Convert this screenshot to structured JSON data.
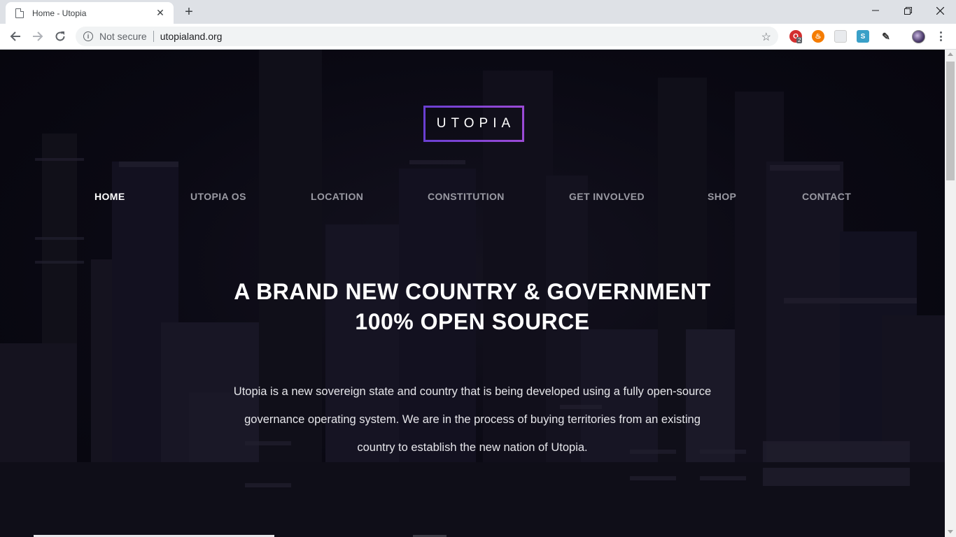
{
  "browser": {
    "tab_title": "Home - Utopia",
    "security_label": "Not secure",
    "url": "utopialand.org",
    "extension_badge": "2"
  },
  "site": {
    "logo_text": "UTOPIA",
    "nav": [
      {
        "label": "HOME",
        "active": true
      },
      {
        "label": "UTOPIA OS"
      },
      {
        "label": "LOCATION"
      },
      {
        "label": "CONSTITUTION"
      },
      {
        "label": "GET INVOLVED"
      },
      {
        "label": "SHOP"
      },
      {
        "label": "CONTACT"
      }
    ],
    "hero": {
      "title_line1": "A BRAND NEW COUNTRY & GOVERNMENT",
      "title_line2": "100% OPEN SOURCE",
      "text_line1": "Utopia is a new sovereign state and country that is being developed using a fully open-source",
      "text_line2": "governance operating system. We are in the process of buying territories from an existing",
      "text_line3": "country to establish the new nation of Utopia."
    }
  },
  "colors": {
    "logo_border_start": "#6a3fd1",
    "logo_border_end": "#9b4ad6",
    "page_background": "#0a0913",
    "nav_active": "#ffffff",
    "nav_inactive": "#9a9aa3"
  }
}
